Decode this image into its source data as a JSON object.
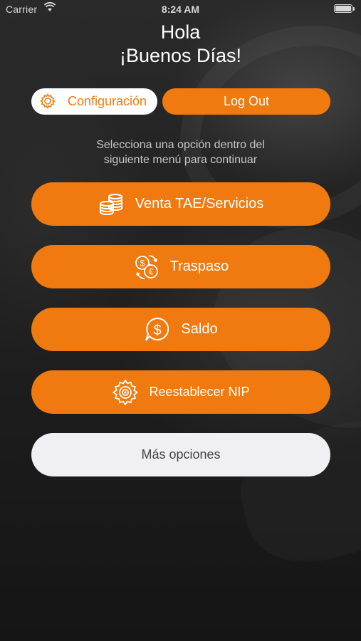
{
  "status_bar": {
    "carrier": "Carrier",
    "time": "8:24 AM"
  },
  "greeting": {
    "line1": "Hola",
    "line2": "¡Buenos Días!"
  },
  "top_buttons": {
    "config_label": "Configuración",
    "logout_label": "Log Out"
  },
  "instructions": {
    "line1": "Selecciona una opción dentro del",
    "line2": "siguiente menú para continuar"
  },
  "menu": [
    {
      "label": "Venta TAE/Servicios",
      "icon": "coins-stack-icon"
    },
    {
      "label": "Traspaso",
      "icon": "currency-exchange-icon"
    },
    {
      "label": "Saldo",
      "icon": "balance-bubble-icon"
    },
    {
      "label": "Reestablecer NIP",
      "icon": "gear-reset-icon"
    }
  ],
  "more_label": "Más opciones",
  "colors": {
    "accent": "#f07a10",
    "more_button_bg": "#efeff4",
    "background": "#1c1c1c"
  }
}
